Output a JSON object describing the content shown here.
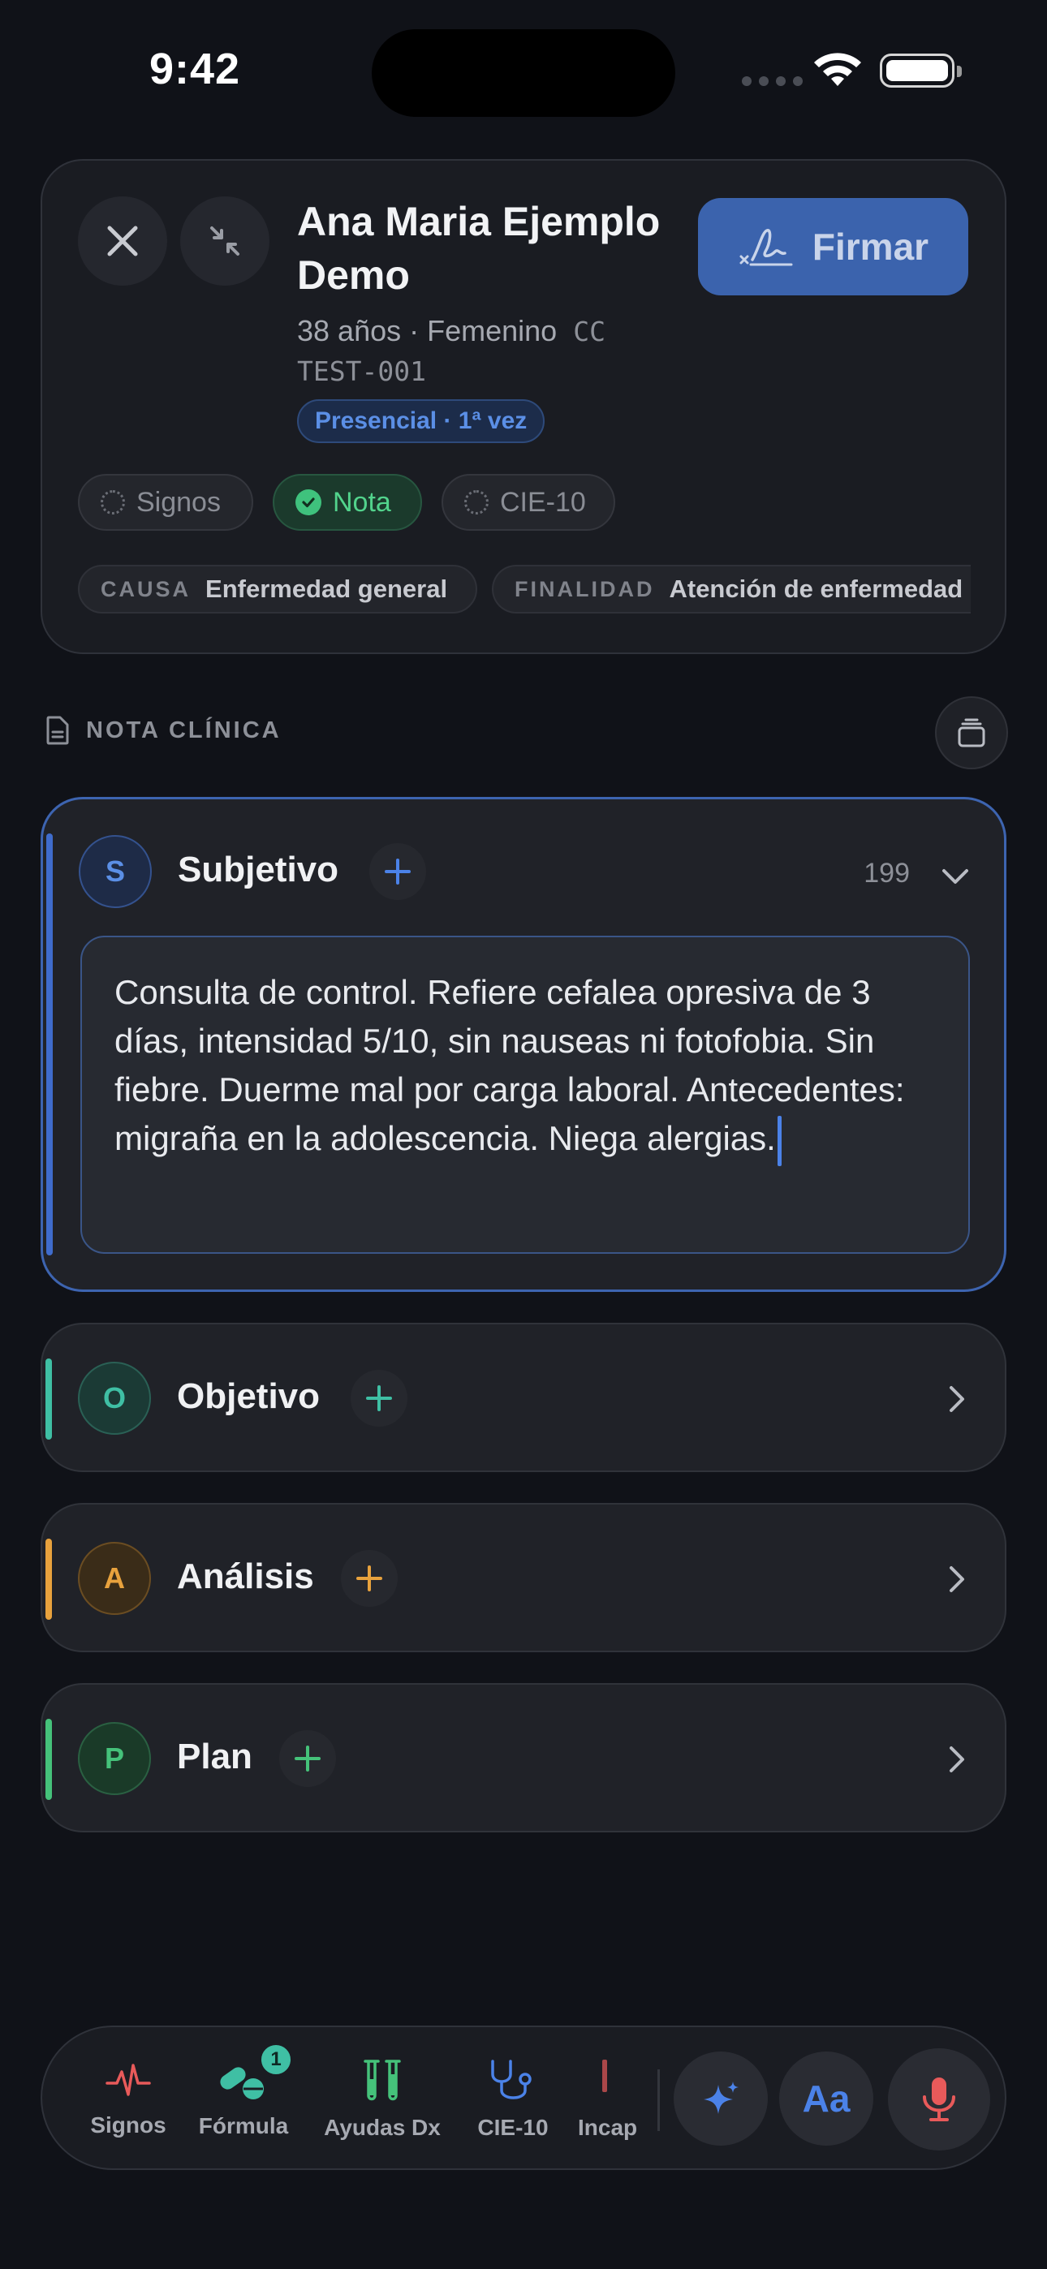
{
  "status_bar": {
    "time": "9:42"
  },
  "header": {
    "close_icon": "close-icon",
    "minimize_icon": "collapse-arrows-icon",
    "patient_name": "Ana Maria Ejemplo Demo",
    "patient_age_sex": "38 años · Femenino",
    "patient_id_prefix": "CC",
    "patient_id": "TEST-001",
    "visit_type": "Presencial · 1ª vez",
    "sign_button": "Firmar",
    "sign_icon": "signature-icon",
    "progress_chips": [
      {
        "label": "Signos",
        "state": "pending"
      },
      {
        "label": "Nota",
        "state": "done"
      },
      {
        "label": "CIE-10",
        "state": "pending"
      }
    ],
    "tags": [
      {
        "key": "CAUSA",
        "value": "Enfermedad general"
      },
      {
        "key": "FINALIDAD",
        "value": "Atención de enfermedad"
      }
    ]
  },
  "section": {
    "title": "NOTA CLÍNICA",
    "icon": "document-icon",
    "history_icon": "stack-icon"
  },
  "soap": {
    "subjective": {
      "letter": "S",
      "title": "Subjetivo",
      "char_count": "199",
      "text": "Consulta de control. Refiere cefalea opresiva de 3 días, intensidad 5/10, sin nauseas ni fotofobia. Sin fiebre. Duerme mal por carga laboral. Antecedentes: migraña en la adolescencia. Niega alergias.",
      "color": "#4b82e8"
    },
    "objective": {
      "letter": "O",
      "title": "Objetivo",
      "color": "#3fbfa4"
    },
    "analysis": {
      "letter": "A",
      "title": "Análisis",
      "color": "#e8a23d"
    },
    "plan": {
      "letter": "P",
      "title": "Plan",
      "color": "#45c27a"
    }
  },
  "toolbar": {
    "items": [
      {
        "label": "Signos",
        "icon": "heartbeat-icon"
      },
      {
        "label": "Fórmula",
        "icon": "pills-icon",
        "badge": "1"
      },
      {
        "label": "Ayudas Dx",
        "icon": "test-tubes-icon"
      },
      {
        "label": "CIE-10",
        "icon": "stethoscope-icon"
      },
      {
        "label": "Incap",
        "icon": "document-icon"
      }
    ],
    "actions": [
      {
        "icon": "sparkles-icon"
      },
      {
        "label": "Aa",
        "icon": "text-size-icon"
      },
      {
        "icon": "microphone-icon"
      }
    ]
  }
}
